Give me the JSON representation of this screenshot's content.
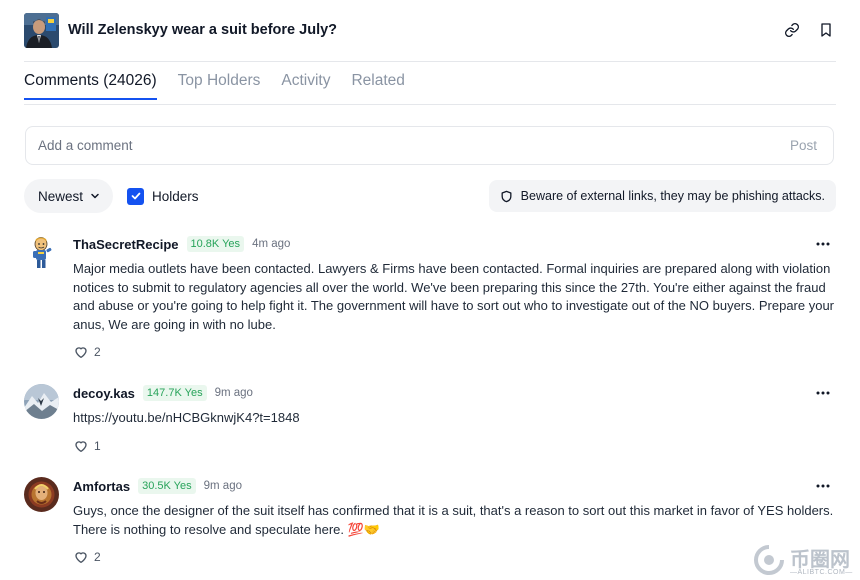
{
  "market": {
    "title": "Will Zelenskyy wear a suit before July?",
    "thumbnail": "zelenskyy-portrait"
  },
  "header_icons": [
    "link-icon",
    "bookmark-icon"
  ],
  "tabs": [
    {
      "label": "Comments (24026)",
      "active": true
    },
    {
      "label": "Top Holders",
      "active": false
    },
    {
      "label": "Activity",
      "active": false
    },
    {
      "label": "Related",
      "active": false
    }
  ],
  "comment_input": {
    "placeholder": "Add a comment",
    "post_label": "Post"
  },
  "controls": {
    "sort_label": "Newest",
    "holders_label": "Holders",
    "holders_checked": true,
    "warning": "Beware of external links, they may be phishing attacks."
  },
  "comments": [
    {
      "username": "ThaSecretRecipe",
      "badge": "10.8K Yes",
      "time": "4m ago",
      "text": "Major media outlets have been contacted. Lawyers & Firms have been contacted. Formal inquiries are prepared along with violation notices to submit to regulatory agencies all over the world. We've been preparing this since the 27th. You're either against the fraud and abuse or you're going to help fight it. The government will have to sort out who to investigate out of the NO buyers. Prepare your anus, We are going in with no lube.",
      "likes": "2"
    },
    {
      "username": "decoy.kas",
      "badge": "147.7K Yes",
      "time": "9m ago",
      "text": "https://youtu.be/nHCBGknwjK4?t=1848",
      "likes": "1"
    },
    {
      "username": "Amfortas",
      "badge": "30.5K Yes",
      "time": "9m ago",
      "text": "Guys, once the designer of the suit itself has confirmed that it is a suit, that's a reason to sort out this market in favor of YES holders. There is nothing to resolve and speculate here. 💯🤝",
      "likes": "2"
    }
  ],
  "watermark": {
    "text": "币圈网",
    "sub": "—ALIBTC.COM—"
  },
  "colors": {
    "accent": "#1452f0",
    "badge_green": "#27a35a",
    "badge_bg": "#eaf7ee"
  }
}
